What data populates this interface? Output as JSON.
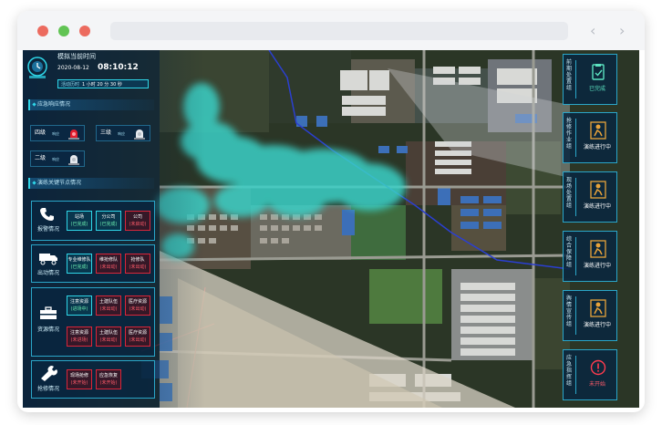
{
  "window": {
    "controls": [
      "close",
      "minimize",
      "maximize"
    ],
    "nav_back_label": "‹",
    "nav_forward_label": "›"
  },
  "header": {
    "title": "模拟当前时间",
    "date": "2020-08-12",
    "time": "08:10:12",
    "elapsed_label": "活动历时",
    "elapsed_value": "1 小时 20 分 30 秒"
  },
  "emergency": {
    "title": "应急响应情况",
    "levels": [
      {
        "name": "四级",
        "sub": "响应"
      },
      {
        "name": "三级",
        "sub": "响应"
      },
      {
        "name": "二级",
        "sub": "响应"
      }
    ]
  },
  "drill": {
    "title": "演练关键节点情况",
    "groups": [
      {
        "label": "报警情况",
        "icon": "phone-icon",
        "items": [
          {
            "name": "站场",
            "status": "(已完成)",
            "state": "done"
          },
          {
            "name": "分公司",
            "status": "(已完成)",
            "state": "done"
          },
          {
            "name": "公司",
            "status": "(未启动)",
            "state": "pending"
          }
        ]
      },
      {
        "label": "出动情况",
        "icon": "truck-icon",
        "items": [
          {
            "name": "专业维修队",
            "status": "(已完成)",
            "state": "done"
          },
          {
            "name": "维抢修队",
            "status": "(未出动)",
            "state": "pending"
          },
          {
            "name": "抢修队",
            "status": "(未出动)",
            "state": "pending"
          }
        ]
      },
      {
        "label": "资源情况",
        "icon": "toolbox-icon",
        "items": [
          {
            "name": "注意资源",
            "status": "(进场中)",
            "state": "done"
          },
          {
            "name": "土建队伍",
            "status": "(未出动)",
            "state": "pending"
          },
          {
            "name": "医疗资源",
            "status": "(未出动)",
            "state": "pending"
          },
          {
            "name": "注意资源",
            "status": "(未进场)",
            "state": "pending"
          },
          {
            "name": "土建队伍",
            "status": "(未出动)",
            "state": "pending"
          },
          {
            "name": "医疗资源",
            "status": "(未出动)",
            "state": "pending"
          }
        ]
      },
      {
        "label": "抢修情况",
        "icon": "wrench-icon",
        "items": [
          {
            "name": "现场抢修",
            "status": "(未开始)",
            "state": "pending"
          },
          {
            "name": "应急恢复",
            "status": "(未开始)",
            "state": "pending"
          }
        ]
      }
    ]
  },
  "right_panels": [
    {
      "name": "前期处置组",
      "status": "已完成",
      "icon": "completed-check-icon"
    },
    {
      "name": "抢修作业组",
      "status": "演练进行中",
      "icon": "worker-icon"
    },
    {
      "name": "现场处置组",
      "status": "演练进行中",
      "icon": "worker-icon"
    },
    {
      "name": "综合保障组",
      "status": "演练进行中",
      "icon": "worker-icon"
    },
    {
      "name": "舆情宣传组",
      "status": "演练进行中",
      "icon": "worker-icon"
    },
    {
      "name": "应急指挥组",
      "status": "未开始",
      "icon": "alert-icon"
    }
  ],
  "colors": {
    "accent": "#2fd6e8",
    "done": "#6cf0b0",
    "pending": "#ff5b6a",
    "in_progress": "#e7a33b",
    "dot_close": "#ec6b5f",
    "dot_min": "#f5bf4f",
    "dot_max": "#61c454"
  }
}
